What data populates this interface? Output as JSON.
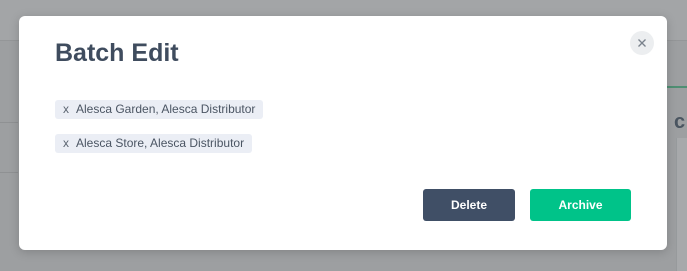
{
  "background": {
    "right_heading_fragment": "c",
    "left_marker": "-"
  },
  "modal": {
    "title": "Batch Edit",
    "close_label": "×",
    "tags": [
      {
        "remove_label": "x",
        "label": "Alesca Garden, Alesca Distributor"
      },
      {
        "remove_label": "x",
        "label": "Alesca Store, Alesca Distributor"
      }
    ],
    "delete_label": "Delete",
    "archive_label": "Archive"
  },
  "colors": {
    "overlay": "#9d9fa1",
    "title": "#3f4c5e",
    "tag_bg": "#ebeef5",
    "delete_bg": "#404f66",
    "archive_bg": "#00c389"
  },
  "icons": {
    "close": "close-icon"
  }
}
